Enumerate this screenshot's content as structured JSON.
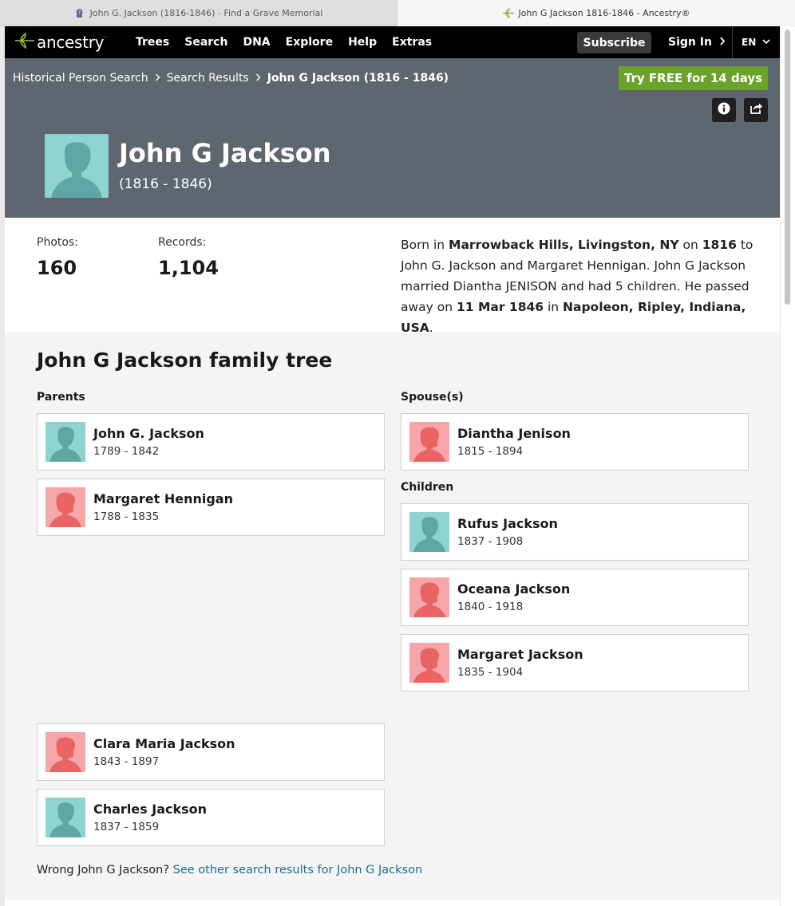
{
  "browser": {
    "tabs": [
      {
        "title": "John G. Jackson (1816-1846) - Find a Grave Memorial",
        "active": false,
        "icon": "findagrave-icon"
      },
      {
        "title": "John G Jackson 1816-1846 - Ancestry®",
        "active": true,
        "icon": "ancestry-leaf-icon"
      }
    ]
  },
  "nav": {
    "logo_text": "ancestry",
    "logo_mark": "·",
    "links": [
      "Trees",
      "Search",
      "DNA",
      "Explore",
      "Help",
      "Extras"
    ],
    "subscribe_label": "Subscribe",
    "signin_label": "Sign In",
    "language": "EN"
  },
  "breadcrumb": {
    "items": [
      "Historical Person Search",
      "Search Results"
    ],
    "current": "John G Jackson (1816 - 1846)"
  },
  "cta": {
    "try_free_label": "Try FREE for 14 days"
  },
  "person": {
    "name": "John G Jackson",
    "dates": "(1816 - 1846)"
  },
  "stats": {
    "photos_label": "Photos:",
    "photos_value": "160",
    "records_label": "Records:",
    "records_value": "1,104"
  },
  "bio": {
    "born_prefix": "Born in ",
    "birth_place": "Marrowback Hills, Livingston, NY",
    "on1": " on ",
    "birth_year": "1816",
    "mid": " to John G. Jackson and Margaret Hennigan. John G Jackson married Diantha JENISON and had 5 children. He passed away on ",
    "death_date": "11 Mar 1846",
    "in": " in ",
    "death_place": "Napoleon, Ripley, Indiana, USA",
    "end": "."
  },
  "tree": {
    "title": "John G Jackson family tree",
    "parents_label": "Parents",
    "spouses_label": "Spouse(s)",
    "children_label": "Children",
    "parents": [
      {
        "name": "John G. Jackson",
        "dates": "1789 - 1842",
        "gender": "male"
      },
      {
        "name": "Margaret Hennigan",
        "dates": "1788 - 1835",
        "gender": "female"
      }
    ],
    "spouses": [
      {
        "name": "Diantha Jenison",
        "dates": "1815 - 1894",
        "gender": "female"
      }
    ],
    "children": [
      {
        "name": "Rufus Jackson",
        "dates": "1837 - 1908",
        "gender": "male"
      },
      {
        "name": "Oceana Jackson",
        "dates": "1840 - 1918",
        "gender": "female"
      },
      {
        "name": "Margaret Jackson",
        "dates": "1835 - 1904",
        "gender": "female"
      },
      {
        "name": "Clara Maria Jackson",
        "dates": "1843 - 1897",
        "gender": "female"
      },
      {
        "name": "Charles Jackson",
        "dates": "1837 - 1859",
        "gender": "male"
      }
    ]
  },
  "footer": {
    "wrong_text": "Wrong John G Jackson? ",
    "other_results_link": "See other search results for John G Jackson"
  },
  "colors": {
    "hero_bg": "#5e6670",
    "cta_green": "#6aa22a",
    "male_avatar": "#8fd3cf",
    "female_avatar": "#f6a6a8",
    "link": "#1a6f8d"
  }
}
